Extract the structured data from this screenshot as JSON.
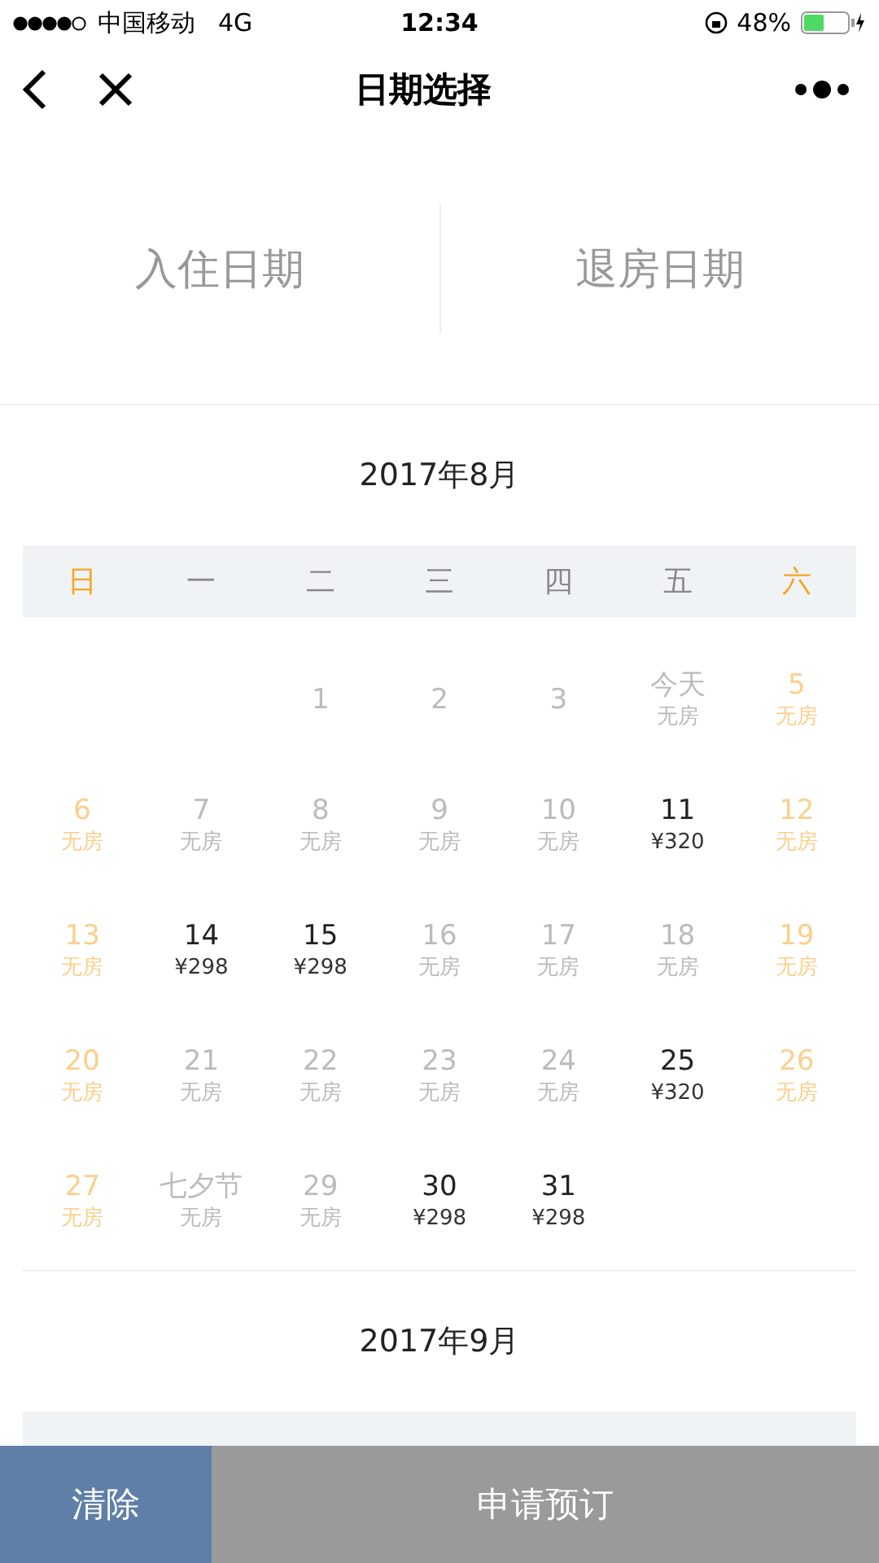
{
  "status_bar": {
    "carrier": "中国移动",
    "network": "4G",
    "time": "12:34",
    "battery": "48%"
  },
  "nav": {
    "title": "日期选择"
  },
  "range": {
    "checkin": "入住日期",
    "checkout": "退房日期"
  },
  "months": [
    {
      "title": "2017年8月",
      "weekdays": [
        {
          "label": "日",
          "highlighted": true
        },
        {
          "label": "一",
          "highlighted": false
        },
        {
          "label": "二",
          "highlighted": false
        },
        {
          "label": "三",
          "highlighted": false
        },
        {
          "label": "四",
          "highlighted": false
        },
        {
          "label": "五",
          "highlighted": false
        },
        {
          "label": "六",
          "highlighted": true
        }
      ],
      "days": [
        {
          "kind": "blank"
        },
        {
          "kind": "blank"
        },
        {
          "kind": "unavailable",
          "label": "1"
        },
        {
          "kind": "unavailable",
          "label": "2"
        },
        {
          "kind": "unavailable",
          "label": "3"
        },
        {
          "kind": "unavailable",
          "label": "今天",
          "sub": "无房"
        },
        {
          "kind": "weekend",
          "label": "5",
          "sub": "无房"
        },
        {
          "kind": "weekend",
          "label": "6",
          "sub": "无房"
        },
        {
          "kind": "unavailable",
          "label": "7",
          "sub": "无房"
        },
        {
          "kind": "unavailable",
          "label": "8",
          "sub": "无房"
        },
        {
          "kind": "unavailable",
          "label": "9",
          "sub": "无房"
        },
        {
          "kind": "unavailable",
          "label": "10",
          "sub": "无房"
        },
        {
          "kind": "available",
          "label": "11",
          "sub": "¥320"
        },
        {
          "kind": "weekend",
          "label": "12",
          "sub": "无房"
        },
        {
          "kind": "weekend",
          "label": "13",
          "sub": "无房"
        },
        {
          "kind": "available",
          "label": "14",
          "sub": "¥298"
        },
        {
          "kind": "available",
          "label": "15",
          "sub": "¥298"
        },
        {
          "kind": "unavailable",
          "label": "16",
          "sub": "无房"
        },
        {
          "kind": "unavailable",
          "label": "17",
          "sub": "无房"
        },
        {
          "kind": "unavailable",
          "label": "18",
          "sub": "无房"
        },
        {
          "kind": "weekend",
          "label": "19",
          "sub": "无房"
        },
        {
          "kind": "weekend",
          "label": "20",
          "sub": "无房"
        },
        {
          "kind": "unavailable",
          "label": "21",
          "sub": "无房"
        },
        {
          "kind": "unavailable",
          "label": "22",
          "sub": "无房"
        },
        {
          "kind": "unavailable",
          "label": "23",
          "sub": "无房"
        },
        {
          "kind": "unavailable",
          "label": "24",
          "sub": "无房"
        },
        {
          "kind": "available",
          "label": "25",
          "sub": "¥320"
        },
        {
          "kind": "weekend",
          "label": "26",
          "sub": "无房"
        },
        {
          "kind": "weekend",
          "label": "27",
          "sub": "无房"
        },
        {
          "kind": "unavailable",
          "label": "七夕节",
          "sub": "无房"
        },
        {
          "kind": "unavailable",
          "label": "29",
          "sub": "无房"
        },
        {
          "kind": "available",
          "label": "30",
          "sub": "¥298"
        },
        {
          "kind": "available",
          "label": "31",
          "sub": "¥298"
        }
      ]
    },
    {
      "title": "2017年9月"
    }
  ],
  "footer": {
    "clear": "清除",
    "submit": "申请预订"
  }
}
